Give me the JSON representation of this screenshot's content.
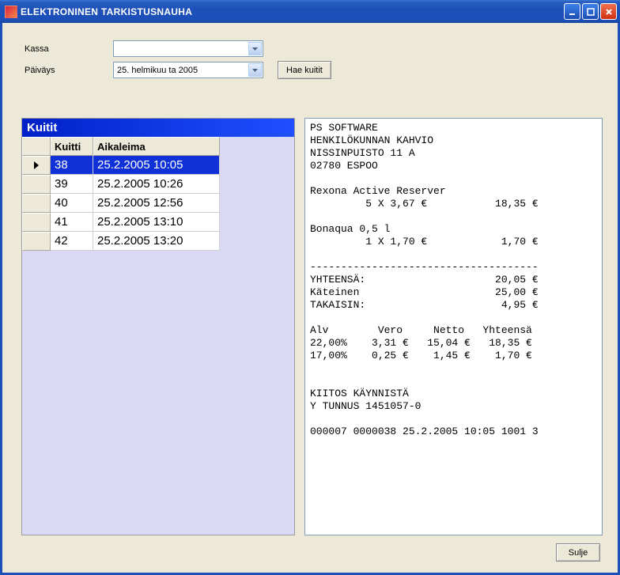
{
  "window": {
    "title": "ELEKTRONINEN TARKISTUSNAUHA"
  },
  "form": {
    "kassa_label": "Kassa",
    "kassa_value": "",
    "paivays_label": "Päiväys",
    "paivays_value": "25. helmikuu ta 2005",
    "hae_label": "Hae kuitit"
  },
  "grid": {
    "title": "Kuitit",
    "col_kuitti": "Kuitti",
    "col_aika": "Aikaleima",
    "rows": [
      {
        "kuitti": "38",
        "aika": "25.2.2005 10:05",
        "selected": true
      },
      {
        "kuitti": "39",
        "aika": "25.2.2005 10:26",
        "selected": false
      },
      {
        "kuitti": "40",
        "aika": "25.2.2005 12:56",
        "selected": false
      },
      {
        "kuitti": "41",
        "aika": "25.2.2005 13:10",
        "selected": false
      },
      {
        "kuitti": "42",
        "aika": "25.2.2005 13:20",
        "selected": false
      }
    ]
  },
  "receipt": {
    "lines": [
      "PS SOFTWARE",
      "HENKILÖKUNNAN KAHVIO",
      "NISSINPUISTO 11 A",
      "02780 ESPOO",
      "",
      "Rexona Active Reserver",
      "         5 X 3,67 €           18,35 €",
      "",
      "Bonaqua 0,5 l",
      "         1 X 1,70 €            1,70 €",
      "",
      "-------------------------------------",
      "YHTEENSÄ:                     20,05 €",
      "Käteinen                      25,00 €",
      "TAKAISIN:                      4,95 €",
      "",
      "Alv        Vero     Netto   Yhteensä",
      "22,00%    3,31 €   15,04 €   18,35 €",
      "17,00%    0,25 €    1,45 €    1,70 €",
      "",
      "",
      "KIITOS KÄYNNISTÄ",
      "Y TUNNUS 1451057-0",
      "",
      "000007 0000038 25.2.2005 10:05 1001 3"
    ]
  },
  "footer": {
    "sulje_label": "Sulje"
  }
}
